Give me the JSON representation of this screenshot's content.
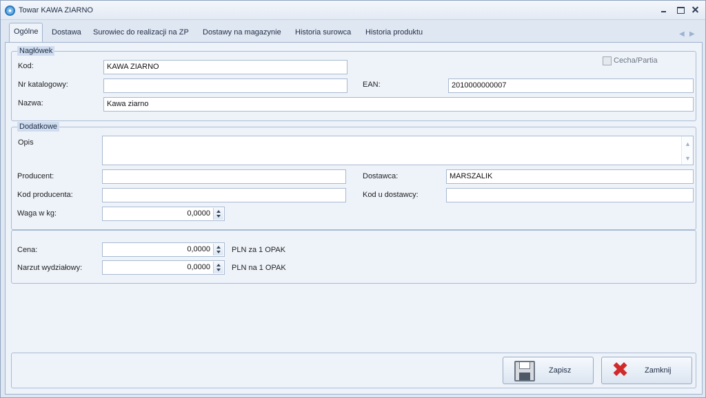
{
  "window": {
    "title": "Towar KAWA ZIARNO"
  },
  "tabs": [
    "Ogólne",
    "Dostawa",
    "Surowiec do realizacji na ZP",
    "Dostawy na magazynie",
    "Historia surowca",
    "Historia produktu"
  ],
  "naglowek": {
    "title": "Nagłówek",
    "cecha_partia_label": "Cecha/Partia",
    "cecha_partia_checked": false,
    "kod_label": "Kod:",
    "kod_value": "KAWA ZIARNO",
    "nr_katalogowy_label": "Nr katalogowy:",
    "nr_katalogowy_value": "",
    "ean_label": "EAN:",
    "ean_value": "2010000000007",
    "nazwa_label": "Nazwa:",
    "nazwa_value": "Kawa ziarno"
  },
  "dodatkowe": {
    "title": "Dodatkowe",
    "opis_label": "Opis",
    "opis_value": "",
    "producent_label": "Producent:",
    "producent_value": "",
    "dostawca_label": "Dostawca:",
    "dostawca_value": "MARSZALIK",
    "kod_producenta_label": "Kod producenta:",
    "kod_producenta_value": "",
    "kod_u_dostawcy_label": "Kod u dostawcy:",
    "kod_u_dostawcy_value": "",
    "waga_label": "Waga w kg:",
    "waga_value": "0,0000"
  },
  "ceny": {
    "cena_label": "Cena:",
    "cena_value": "0,0000",
    "cena_unit": "PLN za 1 OPAK",
    "narzut_label": "Narzut wydziałowy:",
    "narzut_value": "0,0000",
    "narzut_unit": "PLN na 1 OPAK"
  },
  "buttons": {
    "save": "Zapisz",
    "close": "Zamknij"
  }
}
